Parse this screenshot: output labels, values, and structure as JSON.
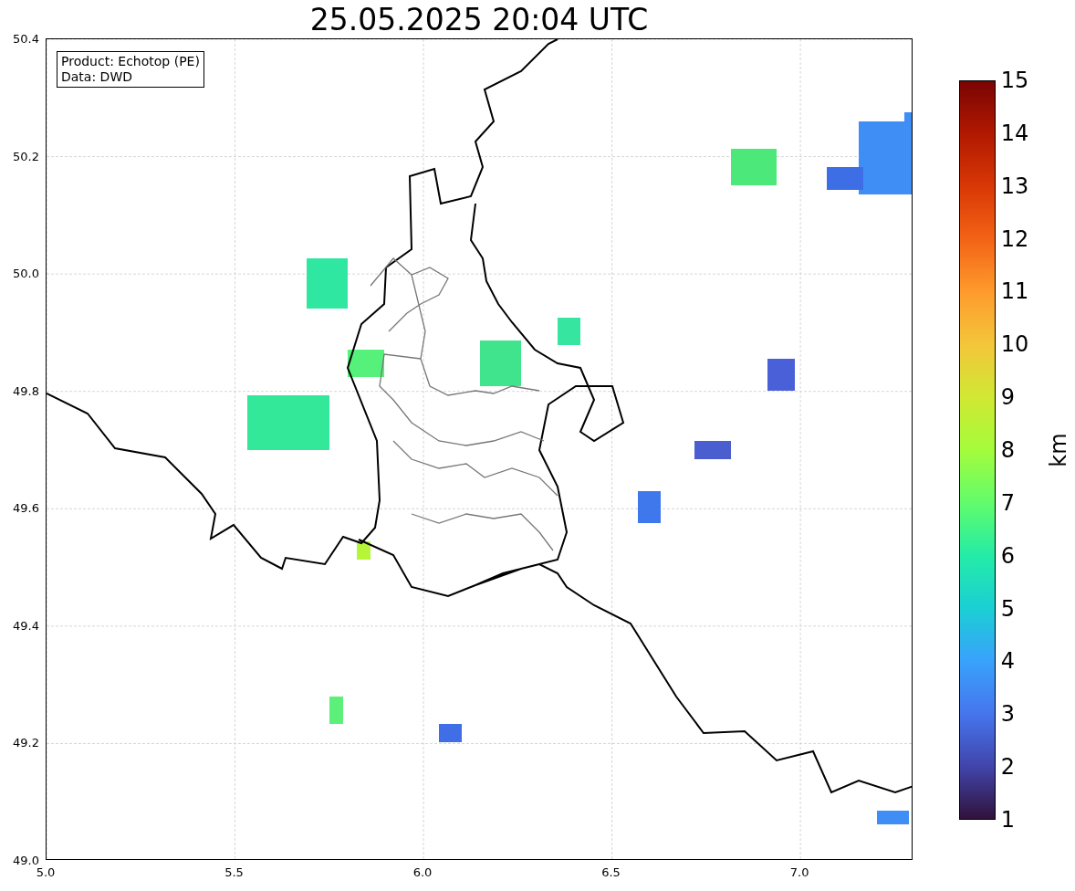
{
  "title": "25.05.2025 20:04 UTC",
  "info_box": [
    "Product: Echotop (PE)",
    "Data: DWD"
  ],
  "x_axis": {
    "ticks": [
      "5.0",
      "5.5",
      "6.0",
      "6.5",
      "7.0"
    ]
  },
  "y_axis": {
    "ticks": [
      "50.4",
      "50.2",
      "50.0",
      "49.8",
      "49.6",
      "49.4",
      "49.2",
      "49.0"
    ]
  },
  "colorbar": {
    "label": "km",
    "ticks": [
      "15",
      "14",
      "13",
      "12",
      "11",
      "10",
      "9",
      "8",
      "7",
      "6",
      "5",
      "4",
      "3",
      "2",
      "1"
    ]
  }
}
